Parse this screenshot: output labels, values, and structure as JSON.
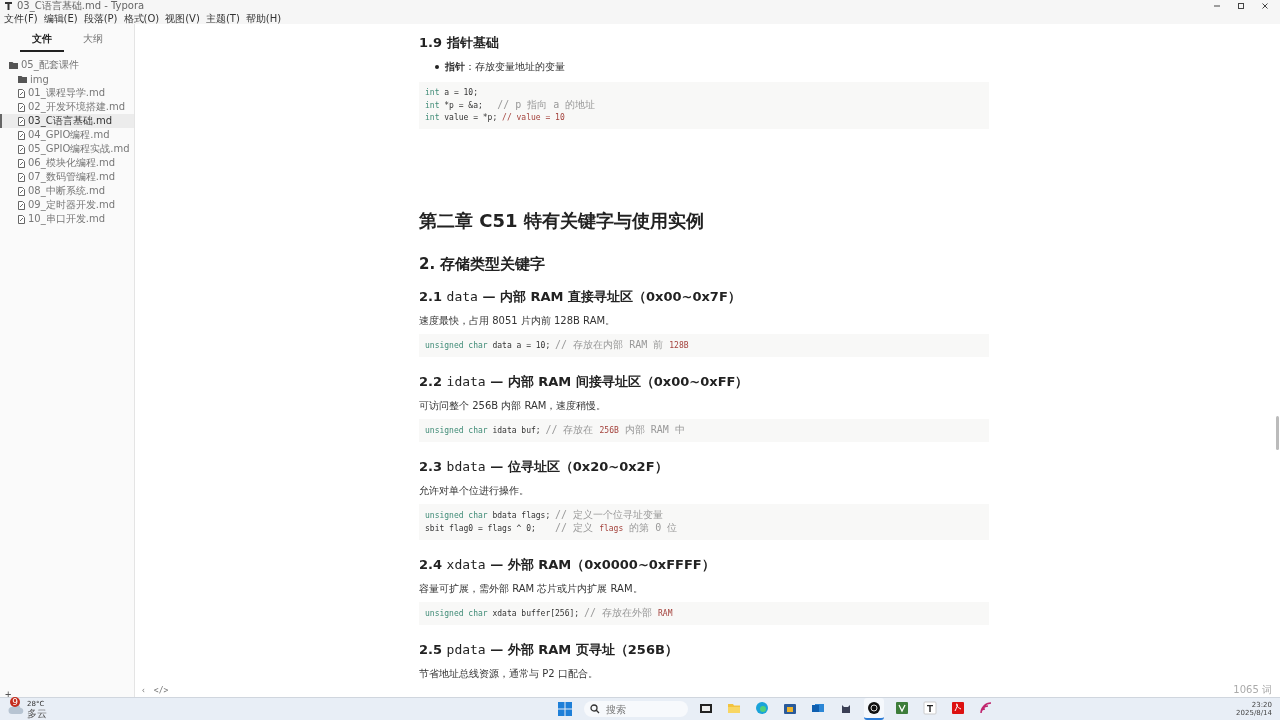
{
  "window": {
    "title": "03_C语言基础.md - Typora"
  },
  "menu": [
    "文件(F)",
    "编辑(E)",
    "段落(P)",
    "格式(O)",
    "视图(V)",
    "主题(T)",
    "帮助(H)"
  ],
  "sidebar": {
    "tabs": [
      {
        "label": "文件",
        "selected": true
      },
      {
        "label": "大纲",
        "selected": false
      }
    ],
    "tree": [
      {
        "label": "05_配套课件",
        "kind": "folder",
        "selected": false,
        "children": [
          {
            "label": "img",
            "kind": "folder",
            "selected": false
          },
          {
            "label": "01_课程导学.md",
            "kind": "file",
            "selected": false
          },
          {
            "label": "02_开发环境搭建.md",
            "kind": "file",
            "selected": false
          },
          {
            "label": "03_C语言基础.md",
            "kind": "file",
            "selected": true
          },
          {
            "label": "04_GPIO编程.md",
            "kind": "file",
            "selected": false
          },
          {
            "label": "05_GPIO编程实战.md",
            "kind": "file",
            "selected": false
          },
          {
            "label": "06_模块化编程.md",
            "kind": "file",
            "selected": false
          },
          {
            "label": "07_数码管编程.md",
            "kind": "file",
            "selected": false
          },
          {
            "label": "08_中断系统.md",
            "kind": "file",
            "selected": false
          },
          {
            "label": "09_定时器开发.md",
            "kind": "file",
            "selected": false
          },
          {
            "label": "10_串口开发.md",
            "kind": "file",
            "selected": false
          }
        ]
      }
    ],
    "add_button": "+"
  },
  "document": [
    {
      "kind": "h3",
      "number": "1.9",
      "title": "指针基础"
    },
    {
      "kind": "bullet",
      "label": "指针",
      "text": "：存放变量地址的变量"
    },
    {
      "kind": "code",
      "lines": [
        [
          {
            "text": "int",
            "kind": "type"
          },
          {
            "text": " a = 10;",
            "kind": "plain"
          }
        ],
        [
          {
            "text": "int",
            "kind": "type"
          },
          {
            "text": " *p = &a;   ",
            "kind": "plain"
          },
          {
            "text": "// p 指向 a 的地址",
            "kind": "comment"
          }
        ],
        [
          {
            "text": "int",
            "kind": "type"
          },
          {
            "text": " value = *p; ",
            "kind": "plain"
          },
          {
            "text": "// value = 10",
            "kind": "var"
          }
        ]
      ]
    },
    {
      "kind": "h1",
      "title": "第二章 C51 特有关键字与使用实例"
    },
    {
      "kind": "h2",
      "title": "2. 存储类型关键字"
    },
    {
      "kind": "h3",
      "number": "2.1",
      "code": "data",
      "title": "— 内部 RAM 直接寻址区（0x00~0x7F）"
    },
    {
      "kind": "para",
      "text": "速度最快，占用 8051 片内前 128B RAM。"
    },
    {
      "kind": "code",
      "lines": [
        [
          {
            "text": "unsigned char",
            "kind": "type"
          },
          {
            "text": " data a = 10; ",
            "kind": "plain"
          },
          {
            "text": "// 存放在内部 RAM 前 ",
            "kind": "comment"
          },
          {
            "text": "128B",
            "kind": "var"
          }
        ]
      ]
    },
    {
      "kind": "h3",
      "number": "2.2",
      "code": "idata",
      "title": "— 内部 RAM 间接寻址区（0x00~0xFF）"
    },
    {
      "kind": "para",
      "text": "可访问整个 256B 内部 RAM，速度稍慢。"
    },
    {
      "kind": "code",
      "lines": [
        [
          {
            "text": "unsigned char",
            "kind": "type"
          },
          {
            "text": " idata buf; ",
            "kind": "plain"
          },
          {
            "text": "// 存放在 ",
            "kind": "comment"
          },
          {
            "text": "256B",
            "kind": "var"
          },
          {
            "text": " 内部 RAM 中",
            "kind": "comment"
          }
        ]
      ]
    },
    {
      "kind": "h3",
      "number": "2.3",
      "code": "bdata",
      "title": "— 位寻址区（0x20~0x2F）"
    },
    {
      "kind": "para",
      "text": "允许对单个位进行操作。"
    },
    {
      "kind": "code",
      "lines": [
        [
          {
            "text": "unsigned char",
            "kind": "type"
          },
          {
            "text": " bdata flags; ",
            "kind": "plain"
          },
          {
            "text": "// 定义一个位寻址变量",
            "kind": "comment"
          }
        ],
        [
          {
            "text": "sbit flag0 = flags ^ 0;    ",
            "kind": "plain"
          },
          {
            "text": "// 定义 ",
            "kind": "comment"
          },
          {
            "text": "flags",
            "kind": "var"
          },
          {
            "text": " 的第 0 位",
            "kind": "comment"
          }
        ]
      ]
    },
    {
      "kind": "h3",
      "number": "2.4",
      "code": "xdata",
      "title": "— 外部 RAM（0x0000~0xFFFF）"
    },
    {
      "kind": "para",
      "text": "容量可扩展，需外部 RAM 芯片或片内扩展 RAM。"
    },
    {
      "kind": "code",
      "lines": [
        [
          {
            "text": "unsigned char",
            "kind": "type"
          },
          {
            "text": " xdata buffer[256]; ",
            "kind": "plain"
          },
          {
            "text": "// 存放在外部 ",
            "kind": "comment"
          },
          {
            "text": "RAM",
            "kind": "var"
          }
        ]
      ]
    },
    {
      "kind": "h3",
      "number": "2.5",
      "code": "pdata",
      "title": "— 外部 RAM 页寻址（256B）"
    },
    {
      "kind": "para",
      "text": "节省地址总线资源，通常与 P2 口配合。"
    }
  ],
  "footer": {
    "back": "‹",
    "source": "</>",
    "word_count": "1065 词"
  },
  "taskbar": {
    "weather": {
      "badge": "9",
      "temp": "28°C",
      "desc": "多云"
    },
    "search": {
      "placeholder": "搜索"
    },
    "apps": [
      {
        "kind": "files",
        "selected": false
      },
      {
        "kind": "folder",
        "selected": false
      },
      {
        "kind": "edge",
        "selected": false
      },
      {
        "kind": "store",
        "selected": false
      },
      {
        "kind": "mail",
        "selected": false
      },
      {
        "kind": "cat",
        "selected": false
      },
      {
        "kind": "obs",
        "selected": true
      },
      {
        "kind": "sheet",
        "selected": false
      },
      {
        "kind": "typora",
        "selected": false
      },
      {
        "kind": "pdf",
        "selected": false
      },
      {
        "kind": "rss",
        "selected": false
      }
    ],
    "time": "23:20",
    "date": "2025/8/14"
  }
}
